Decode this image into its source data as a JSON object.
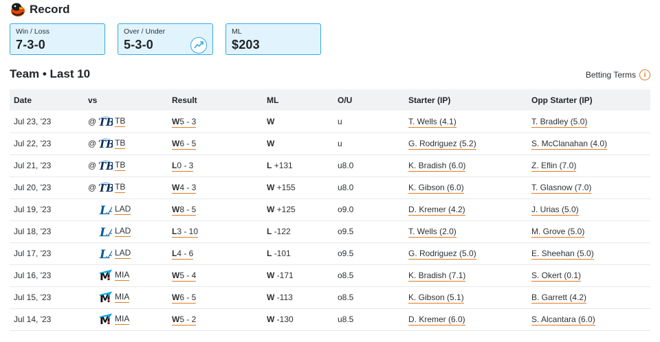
{
  "header": {
    "title": "Record",
    "logo_icon": "orioles-bird-icon"
  },
  "cards": [
    {
      "label": "Win / Loss",
      "value": "7-3-0"
    },
    {
      "label": "Over / Under",
      "value": "5-3-0",
      "icon": "trend-up-icon"
    },
    {
      "label": "ML",
      "value": "$203"
    }
  ],
  "section": {
    "title": "Team • Last 10",
    "terms_label": "Betting Terms",
    "terms_icon": "i"
  },
  "colors": {
    "card_bg": "#e1f4fd",
    "card_border": "#35a8e0",
    "accent": "#e07a1f"
  },
  "table": {
    "columns": [
      "Date",
      "vs",
      "Result",
      "ML",
      "O/U",
      "Starter (IP)",
      "Opp Starter (IP)"
    ],
    "rows": [
      {
        "date": "Jul 23, '23",
        "at": "@",
        "team": "TB",
        "logo": "rays-logo-icon",
        "wl": "W",
        "score": "5 - 3",
        "ml_res": "W",
        "ml_odds": "",
        "ou": "u",
        "starter": "T. Wells (4.1)",
        "opp_starter": "T. Bradley (5.0)"
      },
      {
        "date": "Jul 22, '23",
        "at": "@",
        "team": "TB",
        "logo": "rays-logo-icon",
        "wl": "W",
        "score": "6 - 5",
        "ml_res": "W",
        "ml_odds": "",
        "ou": "u",
        "starter": "G. Rodriguez (5.2)",
        "opp_starter": "S. McClanahan (4.0)"
      },
      {
        "date": "Jul 21, '23",
        "at": "@",
        "team": "TB",
        "logo": "rays-logo-icon",
        "wl": "L",
        "score": "0 - 3",
        "ml_res": "L",
        "ml_odds": "+131",
        "ou": "u8.0",
        "starter": "K. Bradish (6.0)",
        "opp_starter": "Z. Eflin (7.0)"
      },
      {
        "date": "Jul 20, '23",
        "at": "@",
        "team": "TB",
        "logo": "rays-logo-icon",
        "wl": "W",
        "score": "4 - 3",
        "ml_res": "W",
        "ml_odds": "+155",
        "ou": "u8.0",
        "starter": "K. Gibson (6.0)",
        "opp_starter": "T. Glasnow (7.0)"
      },
      {
        "date": "Jul 19, '23",
        "at": "",
        "team": "LAD",
        "logo": "dodgers-logo-icon",
        "wl": "W",
        "score": "8 - 5",
        "ml_res": "W",
        "ml_odds": "+125",
        "ou": "o9.0",
        "starter": "D. Kremer (4.2)",
        "opp_starter": "J. Urias (5.0)"
      },
      {
        "date": "Jul 18, '23",
        "at": "",
        "team": "LAD",
        "logo": "dodgers-logo-icon",
        "wl": "L",
        "score": "3 - 10",
        "ml_res": "L",
        "ml_odds": "-122",
        "ou": "o9.5",
        "starter": "T. Wells (2.0)",
        "opp_starter": "M. Grove (5.0)"
      },
      {
        "date": "Jul 17, '23",
        "at": "",
        "team": "LAD",
        "logo": "dodgers-logo-icon",
        "wl": "L",
        "score": "4 - 6",
        "ml_res": "L",
        "ml_odds": "-101",
        "ou": "o9.5",
        "starter": "G. Rodriguez (5.0)",
        "opp_starter": "E. Sheehan (5.0)"
      },
      {
        "date": "Jul 16, '23",
        "at": "",
        "team": "MIA",
        "logo": "marlins-logo-icon",
        "wl": "W",
        "score": "5 - 4",
        "ml_res": "W",
        "ml_odds": "-171",
        "ou": "o8.5",
        "starter": "K. Bradish (7.1)",
        "opp_starter": "S. Okert (0.1)"
      },
      {
        "date": "Jul 15, '23",
        "at": "",
        "team": "MIA",
        "logo": "marlins-logo-icon",
        "wl": "W",
        "score": "6 - 5",
        "ml_res": "W",
        "ml_odds": "-113",
        "ou": "o8.5",
        "starter": "K. Gibson (5.1)",
        "opp_starter": "B. Garrett (4.2)"
      },
      {
        "date": "Jul 14, '23",
        "at": "",
        "team": "MIA",
        "logo": "marlins-logo-icon",
        "wl": "W",
        "score": "5 - 2",
        "ml_res": "W",
        "ml_odds": "-130",
        "ou": "u8.5",
        "starter": "D. Kremer (6.0)",
        "opp_starter": "S. Alcantara (6.0)"
      }
    ]
  }
}
